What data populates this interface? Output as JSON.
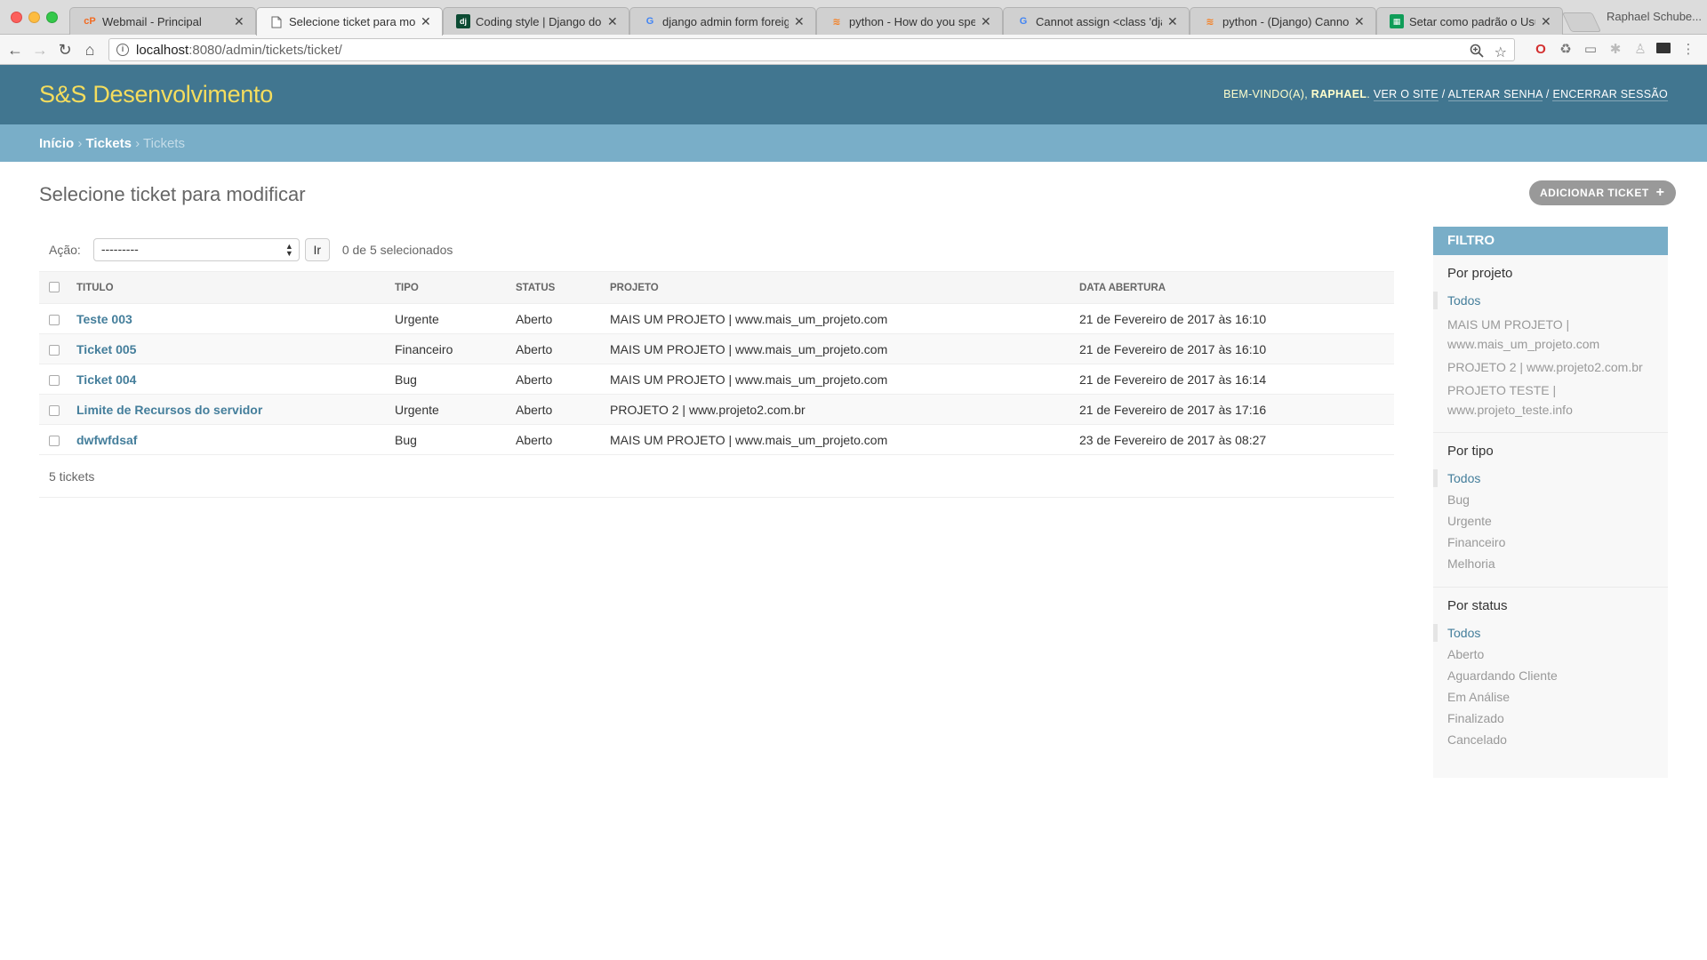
{
  "browser": {
    "tabs": [
      {
        "label": "Webmail - Principal",
        "icon": "cpanel-icon",
        "active": false
      },
      {
        "label": "Selecione ticket para modific",
        "icon": "page-icon",
        "active": true
      },
      {
        "label": "Coding style | Django docu",
        "icon": "django-icon",
        "active": false
      },
      {
        "label": "django admin form foreign",
        "icon": "google-icon",
        "active": false
      },
      {
        "label": "python - How do you speci",
        "icon": "stackoverflow-icon",
        "active": false
      },
      {
        "label": "Cannot assign <class 'djang",
        "icon": "google-icon",
        "active": false
      },
      {
        "label": "python - (Django) Cannot a",
        "icon": "stackoverflow-icon",
        "active": false
      },
      {
        "label": "Setar como padrão o Usuar",
        "icon": "sheets-icon",
        "active": false
      }
    ],
    "profile_name": "Raphael Schube...",
    "url_host": "localhost",
    "url_rest": ":8080/admin/tickets/ticket/"
  },
  "header": {
    "site_name": "S&S Desenvolvimento",
    "welcome": "Bem-vindo(a),",
    "username": "Raphael",
    "view_site": "Ver o site",
    "change_password": "Alterar senha",
    "logout": "Encerrar sessão"
  },
  "breadcrumbs": {
    "home": "Início",
    "app": "Tickets",
    "current": "Tickets"
  },
  "content": {
    "title": "Selecione ticket para modificar",
    "add_button": "Adicionar ticket",
    "action_label": "Ação:",
    "action_selected": "---------",
    "go_button": "Ir",
    "counter": "0 de 5 selecionados",
    "paginator": "5 tickets"
  },
  "table": {
    "headers": [
      "Titulo",
      "Tipo",
      "Status",
      "Projeto",
      "Data abertura"
    ],
    "rows": [
      {
        "titulo": "Teste 003",
        "tipo": "Urgente",
        "status": "Aberto",
        "projeto": "MAIS UM PROJETO | www.mais_um_projeto.com",
        "data": "21 de Fevereiro de 2017 às 16:10"
      },
      {
        "titulo": "Ticket 005",
        "tipo": "Financeiro",
        "status": "Aberto",
        "projeto": "MAIS UM PROJETO | www.mais_um_projeto.com",
        "data": "21 de Fevereiro de 2017 às 16:10"
      },
      {
        "titulo": "Ticket 004",
        "tipo": "Bug",
        "status": "Aberto",
        "projeto": "MAIS UM PROJETO | www.mais_um_projeto.com",
        "data": "21 de Fevereiro de 2017 às 16:14"
      },
      {
        "titulo": "Limite de Recursos do servidor",
        "tipo": "Urgente",
        "status": "Aberto",
        "projeto": "PROJETO 2 | www.projeto2.com.br",
        "data": "21 de Fevereiro de 2017 às 17:16"
      },
      {
        "titulo": "dwfwfdsaf",
        "tipo": "Bug",
        "status": "Aberto",
        "projeto": "MAIS UM PROJETO | www.mais_um_projeto.com",
        "data": "23 de Fevereiro de 2017 às 08:27"
      }
    ]
  },
  "filter": {
    "title": "Filtro",
    "groups": [
      {
        "title": "Por projeto",
        "items": [
          "Todos",
          "MAIS UM PROJETO | www.mais_um_projeto.com",
          "PROJETO 2 | www.projeto2.com.br",
          "PROJETO TESTE | www.projeto_teste.info"
        ]
      },
      {
        "title": "Por tipo",
        "items": [
          "Todos",
          "Bug",
          "Urgente",
          "Financeiro",
          "Melhoria"
        ]
      },
      {
        "title": "Por status",
        "items": [
          "Todos",
          "Aberto",
          "Aguardando Cliente",
          "Em Análise",
          "Finalizado",
          "Cancelado"
        ]
      }
    ]
  },
  "colors": {
    "header_bg": "#417690",
    "breadcrumb_bg": "#79aec8",
    "branding": "#f5dd5d",
    "link": "#447e9b"
  }
}
